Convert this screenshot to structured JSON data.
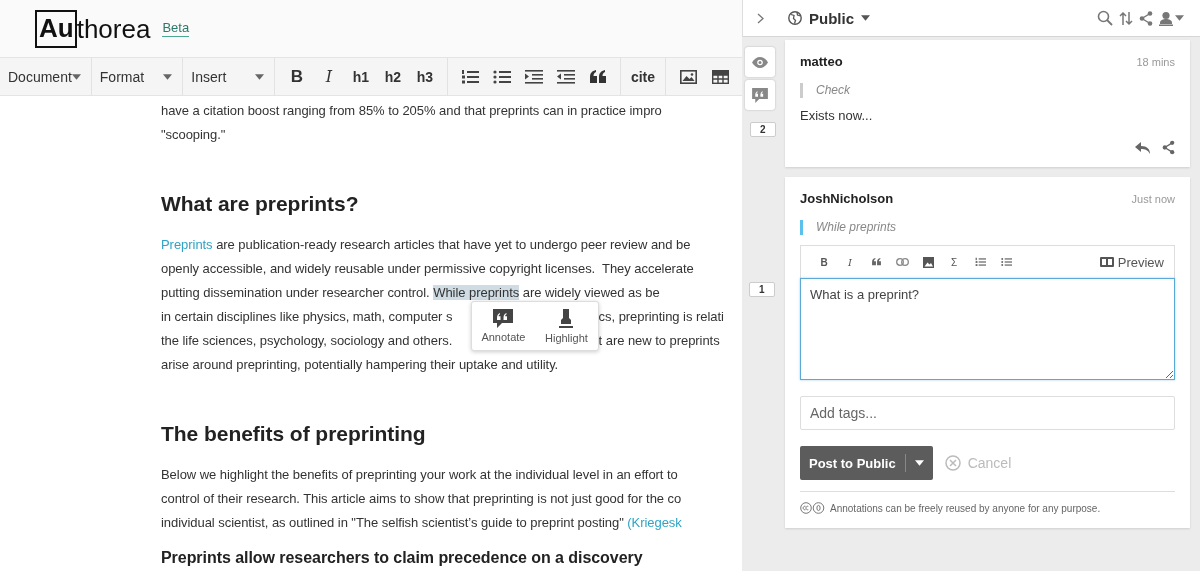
{
  "header": {
    "logo_boxed": "Au",
    "logo_rest": "thorea",
    "badge": "Beta"
  },
  "toolbar": {
    "menus": [
      "Document",
      "Format",
      "Insert"
    ],
    "style_buttons": [
      "B",
      "I",
      "h1",
      "h2",
      "h3"
    ],
    "cite_button": "cite"
  },
  "document": {
    "blocks": [
      {
        "kind": "line",
        "segments": [
          {
            "kind": "plain",
            "text": "have a citation boost ranging from 85% to 205% and that preprints can in practice impro"
          }
        ]
      },
      {
        "kind": "line",
        "segments": [
          {
            "kind": "plain",
            "text": "\"scooping.\""
          }
        ]
      },
      {
        "kind": "h2",
        "text": "What are preprints?"
      },
      {
        "kind": "line",
        "segments": [
          {
            "kind": "link",
            "text": "Preprints"
          },
          {
            "kind": "plain",
            "text": " are publication-ready research articles that have yet to undergo peer review and be"
          }
        ]
      },
      {
        "kind": "line",
        "segments": [
          {
            "kind": "plain",
            "text": "openly accessible, and widely reusable under permissive copyright licenses.  They accelerate"
          }
        ]
      },
      {
        "kind": "line",
        "segments": [
          {
            "kind": "plain",
            "text": "putting dissemination under researcher control. "
          },
          {
            "kind": "highlight",
            "text": "While preprints"
          },
          {
            "kind": "plain",
            "text": " are widely viewed as be"
          }
        ]
      },
      {
        "kind": "popup_lines",
        "left": [
          "in certain disciplines like physics, math, computer s",
          "the life sciences, psychology, sociology and others."
        ],
        "right": [
          "cs, preprinting is relati",
          "t are new to preprints"
        ],
        "actions": [
          "Annotate",
          "Highlight"
        ]
      },
      {
        "kind": "line",
        "segments": [
          {
            "kind": "plain",
            "text": "arise around preprinting, potentially hampering their uptake and utility."
          }
        ]
      },
      {
        "kind": "h2",
        "text": "The benefits of preprinting"
      },
      {
        "kind": "line",
        "segments": [
          {
            "kind": "plain",
            "text": "Below we highlight the benefits of preprinting your work at the individual level in an effort to"
          }
        ]
      },
      {
        "kind": "line",
        "segments": [
          {
            "kind": "plain",
            "text": "control of their research. This article aims to show that preprinting is not just good for the co"
          }
        ]
      },
      {
        "kind": "line",
        "segments": [
          {
            "kind": "plain",
            "text": "individual scientist, as outlined in \"The selfish scientist’s guide to preprint posting\" "
          },
          {
            "kind": "link",
            "text": "(Kriegesk"
          }
        ]
      },
      {
        "kind": "h3",
        "text": "Preprints allow researchers to claim precedence on a discovery"
      }
    ]
  },
  "sidebar": {
    "visibility": "Public",
    "rail_count": "2",
    "anchor_count": "1",
    "annotations": [
      {
        "user": "matteo",
        "time": "18 mins",
        "quote": "Check",
        "body": "Exists now..."
      }
    ],
    "editor": {
      "user": "JoshNicholson",
      "time": "Just now",
      "quote": "While preprints",
      "format_labels": [
        "B",
        "I"
      ],
      "sigma": "Σ",
      "preview": "Preview",
      "text": "What is a preprint?",
      "tags_placeholder": "Add tags...",
      "post": "Post to Public",
      "cancel": "Cancel",
      "license": "Annotations can be freely reused by anyone for any purpose."
    }
  }
}
